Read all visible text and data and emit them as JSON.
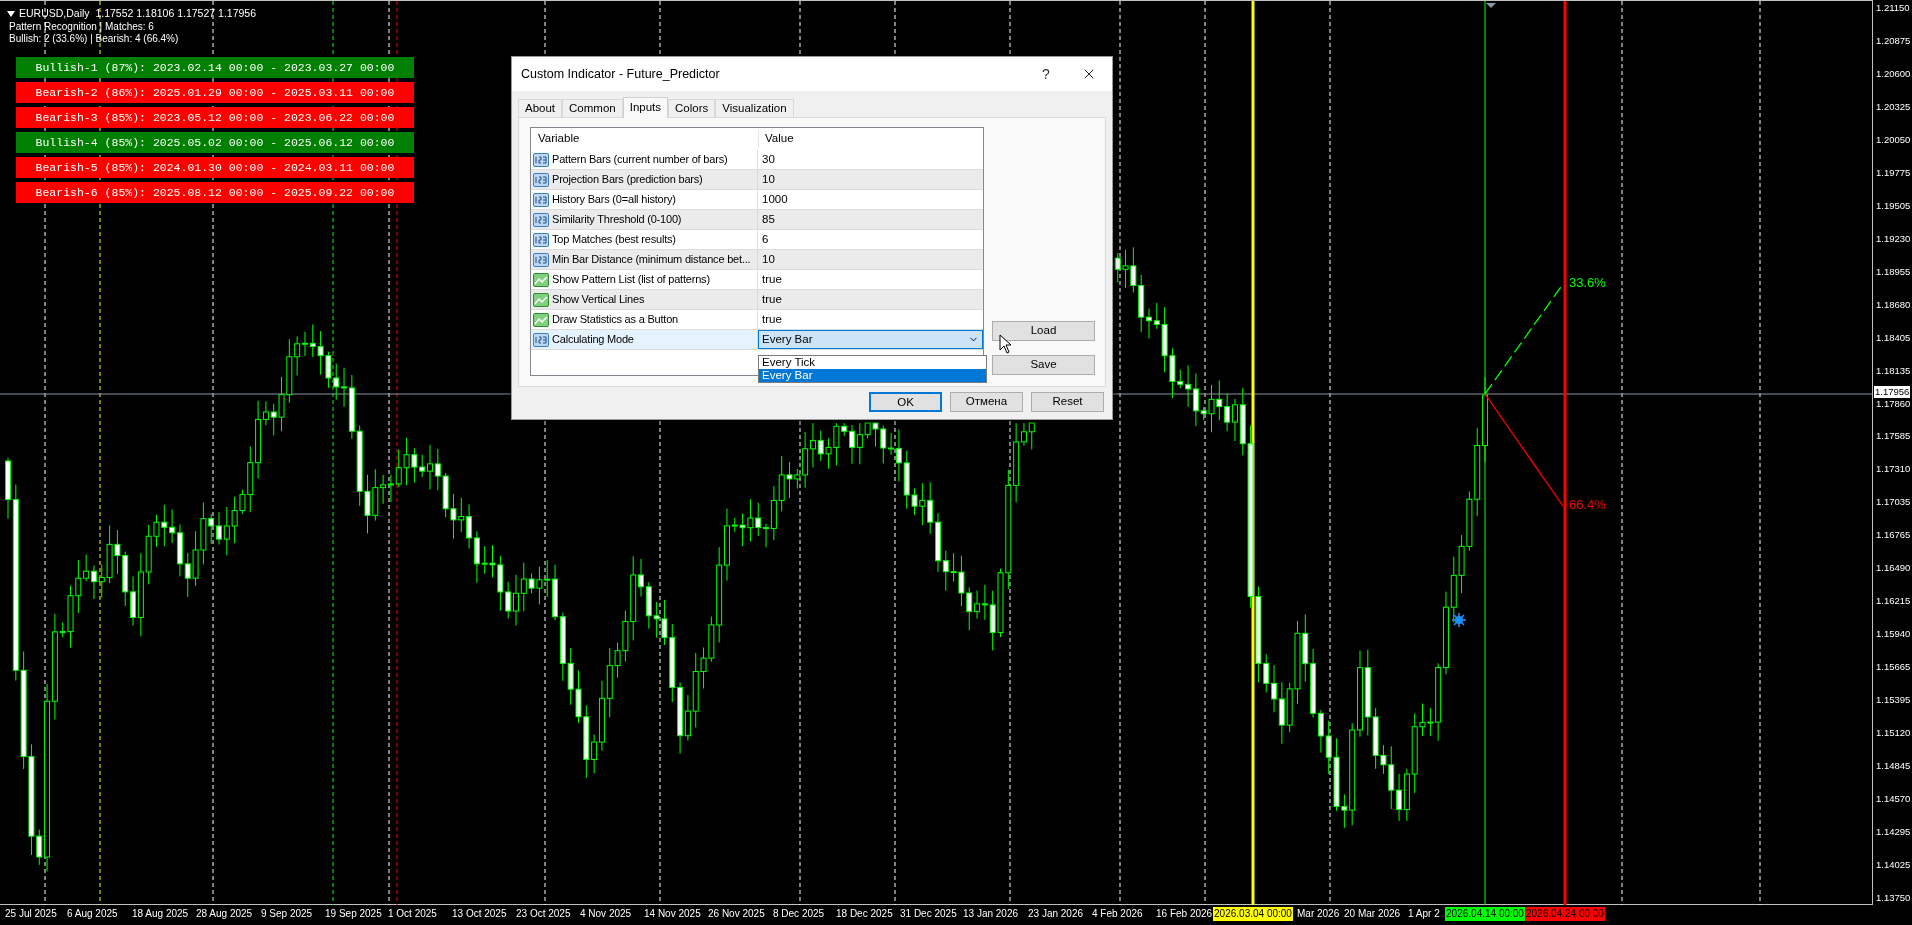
{
  "chart": {
    "header": {
      "symbol_line": "EURUSD,Daily  1.17552 1.18106 1.17527 1.17956",
      "lines": [
        "Pattern Recognition | Matches: 6",
        "Bullish: 2 (33.6%) | Bearish: 4 (66.4%)"
      ]
    },
    "patterns": [
      {
        "label": "Bullish-1 (87%): 2023.02.14 00:00 - 2023.03.27 00:00",
        "color": "#008000"
      },
      {
        "label": "Bearish-2 (86%): 2025.01.29 00:00 - 2025.03.11 00:00",
        "color": "#ff0000"
      },
      {
        "label": "Bearish-3 (85%): 2023.05.12 00:00 - 2023.06.22 00:00",
        "color": "#ff0000"
      },
      {
        "label": "Bullish-4 (85%): 2025.05.02 00:00 - 2025.06.12 00:00",
        "color": "#008000"
      },
      {
        "label": "Bearish-5 (85%): 2024.01.30 00:00 - 2024.03.11 00:00",
        "color": "#ff0000"
      },
      {
        "label": "Bearish-6 (85%): 2025.08.12 00:00 - 2025.09.22 00:00",
        "color": "#ff0000"
      }
    ],
    "projections": [
      {
        "text": "33.6%",
        "color": "#00ff00"
      },
      {
        "text": "66.4%",
        "color": "#ff0000"
      }
    ]
  },
  "price_axis": {
    "labels": [
      "1.21150",
      "1.20875",
      "1.20600",
      "1.20325",
      "1.20050",
      "1.19775",
      "1.19505",
      "1.19230",
      "1.18955",
      "1.18680",
      "1.18405",
      "1.18135",
      "1.17860",
      "1.17585",
      "1.17310",
      "1.17035",
      "1.16765",
      "1.16490",
      "1.16215",
      "1.15940",
      "1.15665",
      "1.15395",
      "1.15120",
      "1.14845",
      "1.14570",
      "1.14295",
      "1.14025",
      "1.13750"
    ],
    "current": "1.17956"
  },
  "time_axis": {
    "labels": [
      "25 Jul 2025",
      "6 Aug 2025",
      "18 Aug 2025",
      "28 Aug 2025",
      "9 Sep 2025",
      "19 Sep 2025",
      "1 Oct 2025",
      "13 Oct 2025",
      "23 Oct 2025",
      "4 Nov 2025",
      "14 Nov 2025",
      "26 Nov 2025",
      "8 Dec 2025",
      "18 Dec 2025",
      "31 Dec 2025",
      "13 Jan 2026",
      "23 Jan 2026",
      "4 Feb 2026",
      "16 Feb 2026",
      "Mar 2026",
      "20 Mar 2026",
      "1 Apr 2"
    ],
    "markers": [
      {
        "text": "2026.03.04 00:00",
        "color": "#ffff00"
      },
      {
        "text": "2026.04.14 00:00",
        "color": "#00ff00"
      },
      {
        "text": "2026.04.24 00:00",
        "color": "#ff0000"
      }
    ]
  },
  "dialog": {
    "title": "Custom Indicator - Future_Predictor",
    "help": "?",
    "tabs": [
      {
        "label": "About",
        "selected": false
      },
      {
        "label": "Common",
        "selected": false
      },
      {
        "label": "Inputs",
        "selected": true
      },
      {
        "label": "Colors",
        "selected": false
      },
      {
        "label": "Visualization",
        "selected": false
      }
    ],
    "columns": [
      "Variable",
      "Value"
    ],
    "rows": [
      {
        "kind": "number",
        "variable": "Pattern Bars (current number of bars)",
        "value": "30",
        "selected": false
      },
      {
        "kind": "number",
        "variable": "Projection Bars (prediction bars)",
        "value": "10",
        "selected": false
      },
      {
        "kind": "number",
        "variable": "History Bars (0=all history)",
        "value": "1000",
        "selected": false
      },
      {
        "kind": "number",
        "variable": "Similarity Threshold (0-100)",
        "value": "85",
        "selected": false
      },
      {
        "kind": "number",
        "variable": "Top Matches (best results)",
        "value": "6",
        "selected": false
      },
      {
        "kind": "number",
        "variable": "Min Bar Distance (minimum distance bet...",
        "value": "10",
        "selected": false
      },
      {
        "kind": "boolean",
        "variable": "Show Pattern List (list of patterns)",
        "value": "true",
        "selected": false
      },
      {
        "kind": "boolean",
        "variable": "Show Vertical Lines",
        "value": "true",
        "selected": false
      },
      {
        "kind": "boolean",
        "variable": "Draw Statistics as a Button",
        "value": "true",
        "selected": false
      },
      {
        "kind": "number",
        "variable": "Calculating Mode",
        "value": "Every Bar",
        "selected": true
      }
    ],
    "dropdown": [
      {
        "label": "Every Tick",
        "selected": false
      },
      {
        "label": "Every Bar",
        "selected": true
      }
    ],
    "side_buttons": [
      "Load",
      "Save"
    ],
    "buttons": [
      "OK",
      "Отмена",
      "Reset"
    ]
  }
}
